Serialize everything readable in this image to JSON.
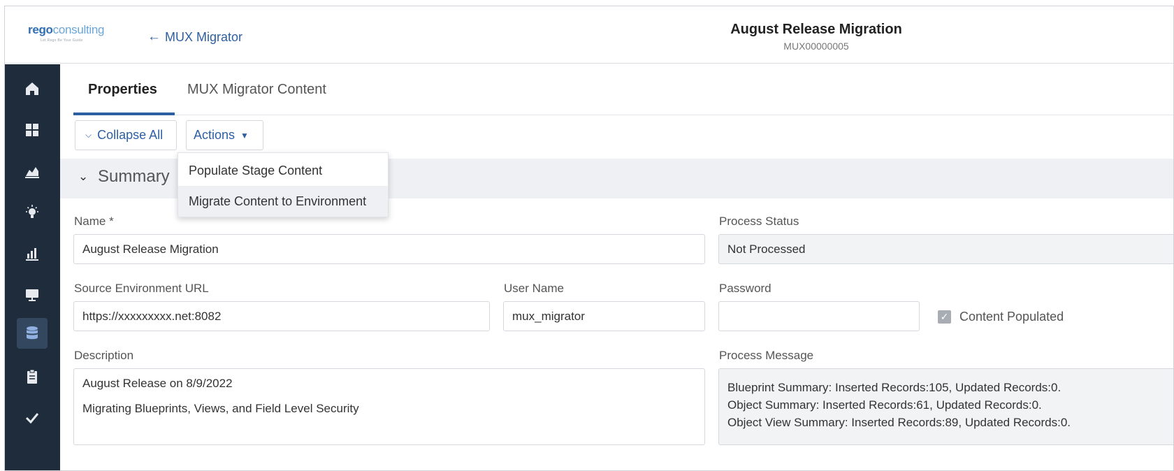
{
  "header": {
    "logo": {
      "part1": "rego",
      "part2": "consulting",
      "tagline": "Let Rego Be Your Guide"
    },
    "back_arrow": "←",
    "back_label": "MUX Migrator",
    "title": "August Release Migration",
    "record_id": "MUX00000005"
  },
  "sidebar": {
    "items": [
      {
        "icon": "home-icon"
      },
      {
        "icon": "grid-icon"
      },
      {
        "icon": "area-chart-icon"
      },
      {
        "icon": "lightbulb-icon"
      },
      {
        "icon": "bar-chart-icon"
      },
      {
        "icon": "monitor-icon"
      },
      {
        "icon": "database-icon",
        "active": true
      },
      {
        "icon": "clipboard-icon"
      },
      {
        "icon": "check-icon"
      }
    ]
  },
  "tabs": [
    {
      "label": "Properties",
      "active": true
    },
    {
      "label": "MUX Migrator Content",
      "active": false
    }
  ],
  "toolbar": {
    "collapse_label": "Collapse All",
    "actions_label": "Actions"
  },
  "actions_menu": {
    "items": [
      "Populate Stage Content",
      "Migrate Content to Environment"
    ],
    "hovered_index": 1
  },
  "section": {
    "title": "Summary"
  },
  "form": {
    "name_label": "Name",
    "required_mark": "*",
    "name_value": "August Release Migration",
    "process_status_label": "Process Status",
    "process_status_value": "Not Processed",
    "source_url_label": "Source Environment URL",
    "source_url_value": "https://xxxxxxxxx.net:8082",
    "user_name_label": "User Name",
    "user_name_value": "mux_migrator",
    "password_label": "Password",
    "password_value": "",
    "content_populated_label": "Content Populated",
    "content_populated_checked": true,
    "description_label": "Description",
    "description_lines": [
      "August Release on 8/9/2022",
      "",
      "Migrating Blueprints, Views, and Field Level Security"
    ],
    "process_message_label": "Process Message",
    "process_message_lines": [
      "Blueprint Summary: Inserted Records:105, Updated Records:0.",
      "Object Summary: Inserted Records:61, Updated Records:0.",
      "Object View Summary: Inserted Records:89, Updated Records:0."
    ]
  },
  "colors": {
    "accent": "#2d5fa3",
    "sidebar_bg": "#1f2c3b",
    "sidebar_active": "#33485f",
    "band_bg": "#eef0f4"
  }
}
